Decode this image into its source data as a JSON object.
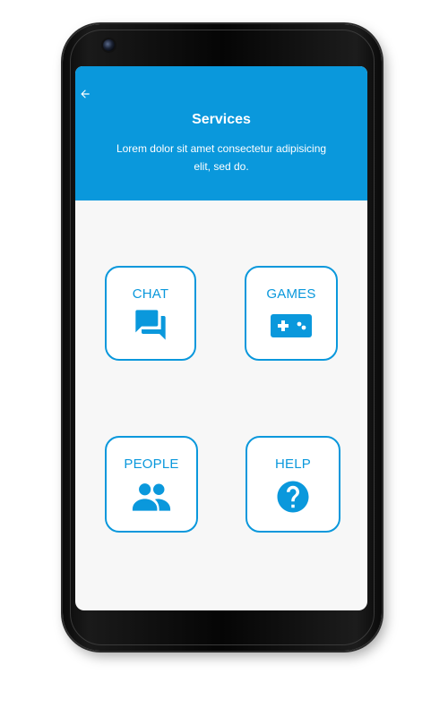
{
  "header": {
    "title": "Services",
    "subtitle": "Lorem dolor sit amet consectetur adipisicing elit, sed do.",
    "back_icon": "arrow-left-icon"
  },
  "services": [
    {
      "label": "CHAT",
      "icon": "chat-icon"
    },
    {
      "label": "GAMES",
      "icon": "gamepad-icon"
    },
    {
      "label": "PEOPLE",
      "icon": "people-icon"
    },
    {
      "label": "HELP",
      "icon": "help-icon"
    }
  ],
  "colors": {
    "accent": "#0a98dc",
    "screen_bg": "#f7f7f7",
    "card_bg": "#ffffff",
    "phone_frame": "#0a0a0a"
  }
}
